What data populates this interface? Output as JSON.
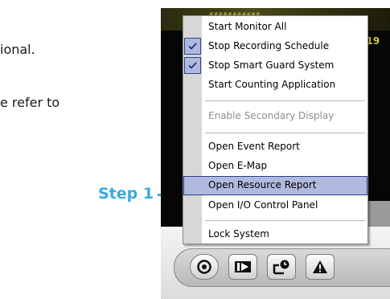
{
  "document": {
    "text_line_1": "ional.",
    "text_line_2": "e refer to"
  },
  "annotation": {
    "step_label": "Step 1",
    "color": "#3aa8df"
  },
  "video": {
    "top_stamp": "###########",
    "side_stamp": "(19"
  },
  "menu": {
    "items": [
      {
        "label": "Start Monitor All",
        "checked": false,
        "disabled": false,
        "highlighted": false
      },
      {
        "label": "Stop Recording Schedule",
        "checked": true,
        "disabled": false,
        "highlighted": false
      },
      {
        "label": "Stop Smart Guard System",
        "checked": true,
        "disabled": false,
        "highlighted": false
      },
      {
        "label": "Start Counting Application",
        "checked": false,
        "disabled": false,
        "highlighted": false
      },
      {
        "label": "Enable Secondary Display",
        "checked": false,
        "disabled": true,
        "highlighted": false
      },
      {
        "label": "Open Event Report",
        "checked": false,
        "disabled": false,
        "highlighted": false
      },
      {
        "label": "Open E-Map",
        "checked": false,
        "disabled": false,
        "highlighted": false
      },
      {
        "label": "Open Resource Report",
        "checked": false,
        "disabled": false,
        "highlighted": true
      },
      {
        "label": "Open I/O Control Panel",
        "checked": false,
        "disabled": false,
        "highlighted": false
      },
      {
        "label": "Lock System",
        "checked": false,
        "disabled": false,
        "highlighted": false
      }
    ],
    "highlight_color": "#b0b9de"
  },
  "toolbar": {
    "buttons": [
      "record-icon",
      "playback-icon",
      "schedule-icon",
      "alert-icon"
    ]
  }
}
